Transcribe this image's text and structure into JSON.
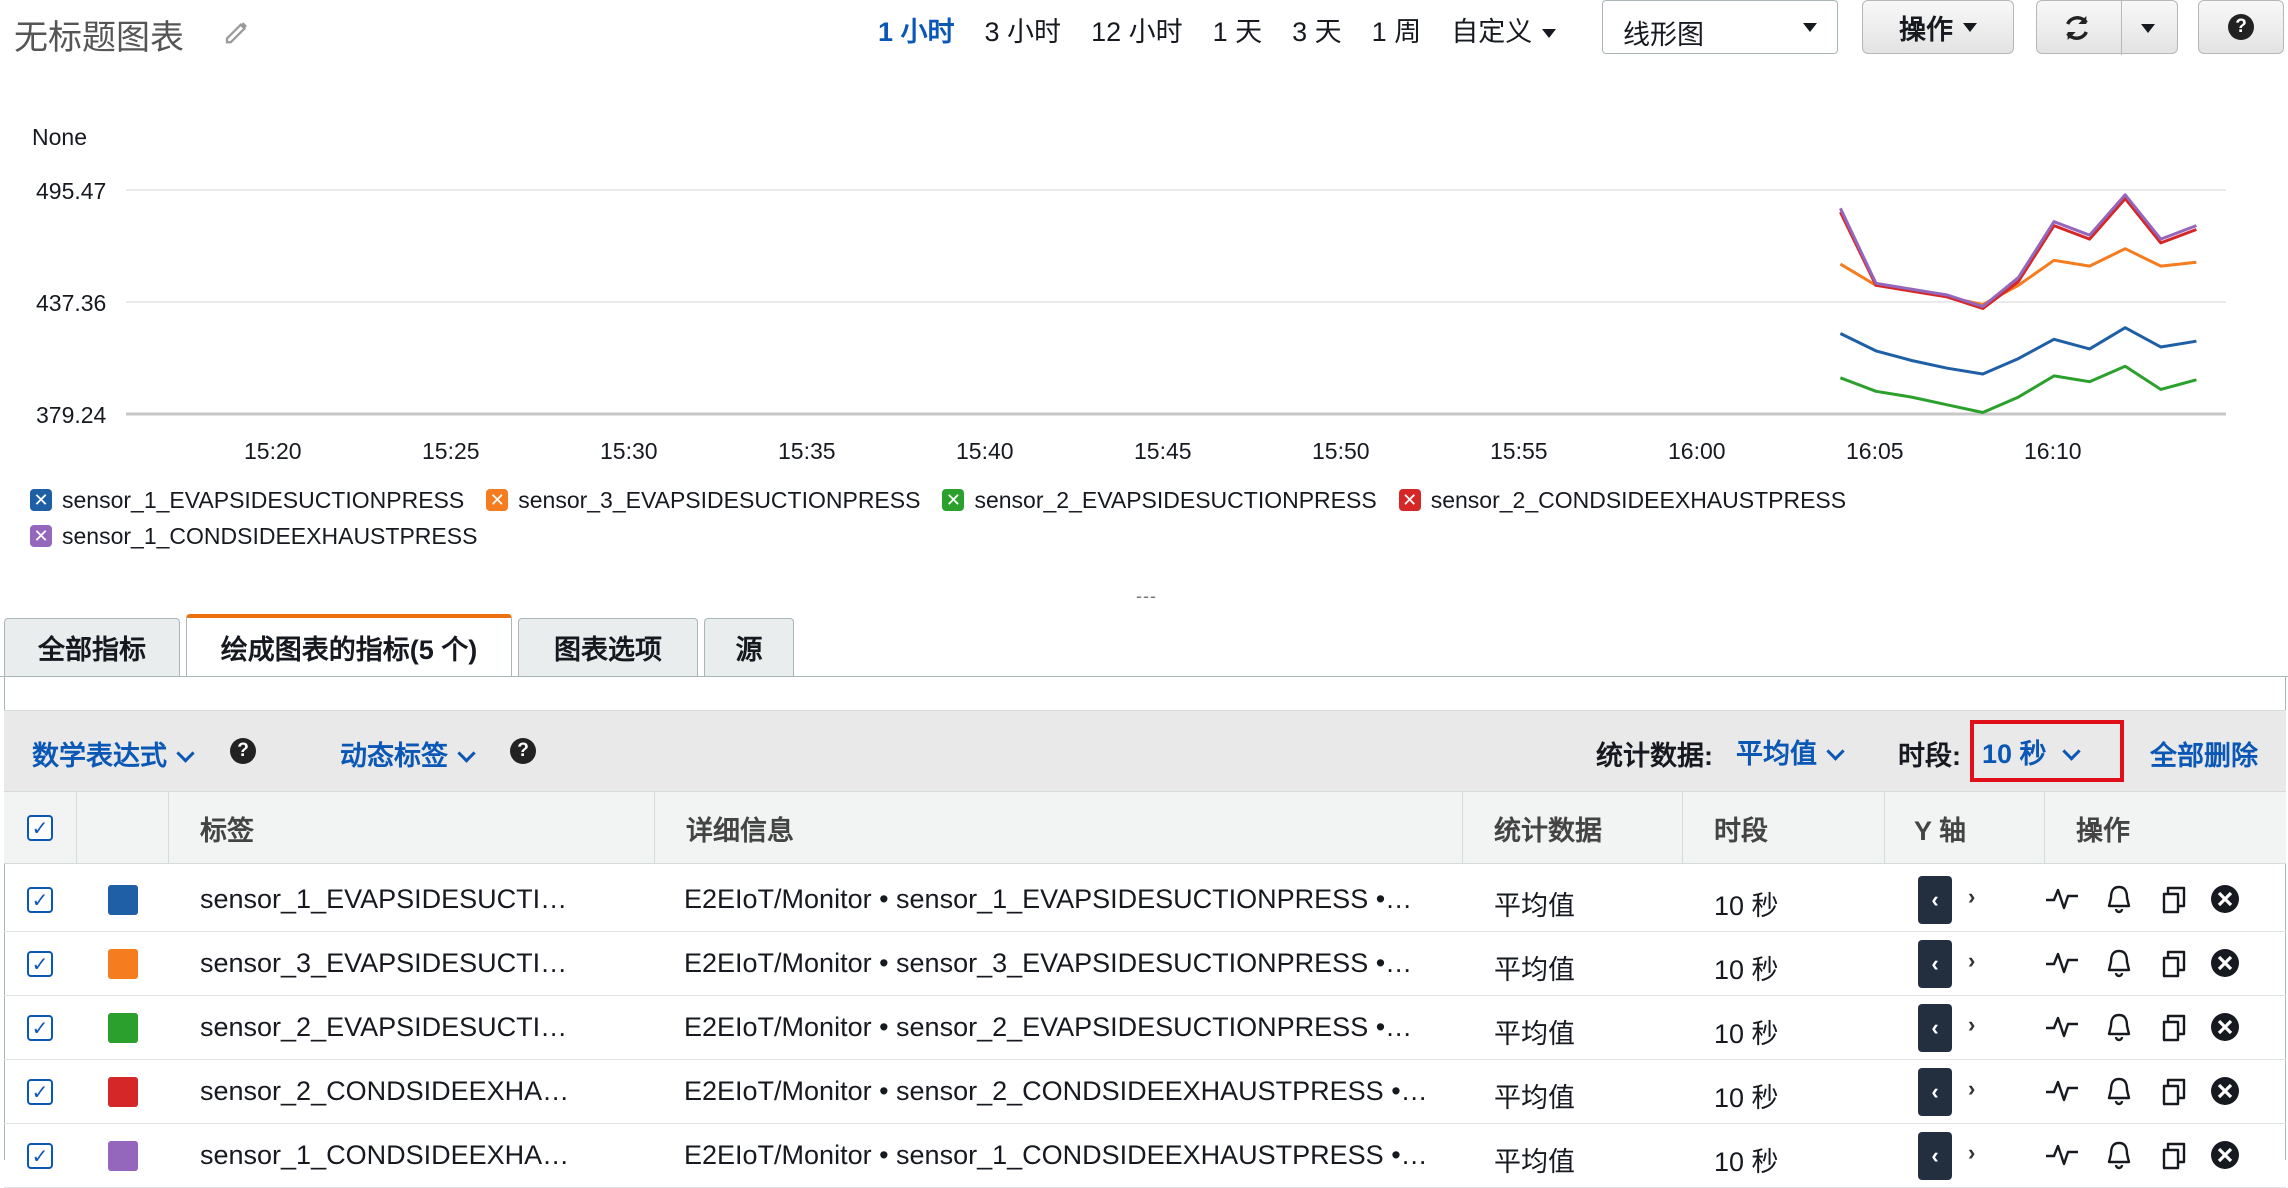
{
  "header": {
    "title": "无标题图表",
    "time_ranges": [
      "1 小时",
      "3 小时",
      "12 小时",
      "1 天",
      "3 天",
      "1 周",
      "自定义"
    ],
    "active_range": "1 小时",
    "chart_type": "线形图",
    "ops_label": "操作"
  },
  "chart": {
    "y_axis_label": "None",
    "y_ticks": [
      "495.47",
      "437.36",
      "379.24"
    ],
    "x_ticks": [
      "15:20",
      "15:25",
      "15:30",
      "15:35",
      "15:40",
      "15:45",
      "15:50",
      "15:55",
      "16:00",
      "16:05",
      "16:10"
    ],
    "legend": [
      {
        "label": "sensor_1_EVAPSIDESUCTIONPRESS",
        "color": "#1f5fa6"
      },
      {
        "label": "sensor_3_EVAPSIDESUCTIONPRESS",
        "color": "#f57c1f"
      },
      {
        "label": "sensor_2_EVAPSIDESUCTIONPRESS",
        "color": "#2ca02c"
      },
      {
        "label": "sensor_2_CONDSIDEEXHAUSTPRESS",
        "color": "#d62728"
      },
      {
        "label": "sensor_1_CONDSIDEEXHAUSTPRESS",
        "color": "#9467bd"
      }
    ]
  },
  "chart_data": {
    "type": "line",
    "y_axis_label": "None",
    "ylim": [
      379.24,
      495.47
    ],
    "y_ticks": [
      495.47,
      437.36,
      379.24
    ],
    "x": [
      "16:04",
      "16:05",
      "16:06",
      "16:07",
      "16:08",
      "16:09",
      "16:10",
      "16:11",
      "16:12",
      "16:13",
      "16:14"
    ],
    "series": [
      {
        "name": "sensor_1_EVAPSIDESUCTIONPRESS",
        "color": "#1f5fa6",
        "values": [
          421,
          412,
          407,
          403,
          400,
          408,
          418,
          413,
          424,
          414,
          417
        ]
      },
      {
        "name": "sensor_3_EVAPSIDESUCTIONPRESS",
        "color": "#f57c1f",
        "values": [
          457,
          446,
          444,
          440,
          436,
          446,
          459,
          456,
          465,
          456,
          458
        ]
      },
      {
        "name": "sensor_2_EVAPSIDESUCTIONPRESS",
        "color": "#2ca02c",
        "values": [
          398,
          391,
          388,
          384,
          380,
          388,
          399,
          396,
          404,
          392,
          397
        ]
      },
      {
        "name": "sensor_2_CONDSIDEEXHAUSTPRESS",
        "color": "#d62728",
        "values": [
          484,
          446,
          443,
          440,
          434,
          448,
          477,
          470,
          491,
          468,
          475
        ]
      },
      {
        "name": "sensor_1_CONDSIDEEXHAUSTPRESS",
        "color": "#9467bd",
        "values": [
          486,
          447,
          444,
          441,
          435,
          450,
          479,
          472,
          493,
          470,
          477
        ]
      }
    ]
  },
  "resize_grip": "---",
  "tabs": [
    "全部指标",
    "绘成图表的指标(5 个)",
    "图表选项",
    "源"
  ],
  "active_tab": 1,
  "toolbar": {
    "math_expression": "数学表达式",
    "dynamic_labels": "动态标签",
    "statistic_label": "统计数据:",
    "statistic_value": "平均值",
    "period_label": "时段:",
    "period_value": "10 秒",
    "delete_all": "全部删除"
  },
  "table": {
    "columns": [
      "标签",
      "详细信息",
      "统计数据",
      "时段",
      "Y 轴",
      "操作"
    ],
    "rows": [
      {
        "color": "#1f5fa6",
        "label": "sensor_1_EVAPSIDESUCTI…",
        "details": "E2EIoT/Monitor • sensor_1_EVAPSIDESUCTIONPRESS •…",
        "stat": "平均值",
        "period": "10 秒"
      },
      {
        "color": "#f57c1f",
        "label": "sensor_3_EVAPSIDESUCTI…",
        "details": "E2EIoT/Monitor • sensor_3_EVAPSIDESUCTIONPRESS •…",
        "stat": "平均值",
        "period": "10 秒"
      },
      {
        "color": "#2ca02c",
        "label": "sensor_2_EVAPSIDESUCTI…",
        "details": "E2EIoT/Monitor • sensor_2_EVAPSIDESUCTIONPRESS •…",
        "stat": "平均值",
        "period": "10 秒"
      },
      {
        "color": "#d62728",
        "label": "sensor_2_CONDSIDEEXHA…",
        "details": "E2EIoT/Monitor • sensor_2_CONDSIDEEXHAUSTPRESS •…",
        "stat": "平均值",
        "period": "10 秒"
      },
      {
        "color": "#9467bd",
        "label": "sensor_1_CONDSIDEEXHA…",
        "details": "E2EIoT/Monitor • sensor_1_CONDSIDEEXHAUSTPRESS •…",
        "stat": "平均值",
        "period": "10 秒"
      }
    ]
  }
}
